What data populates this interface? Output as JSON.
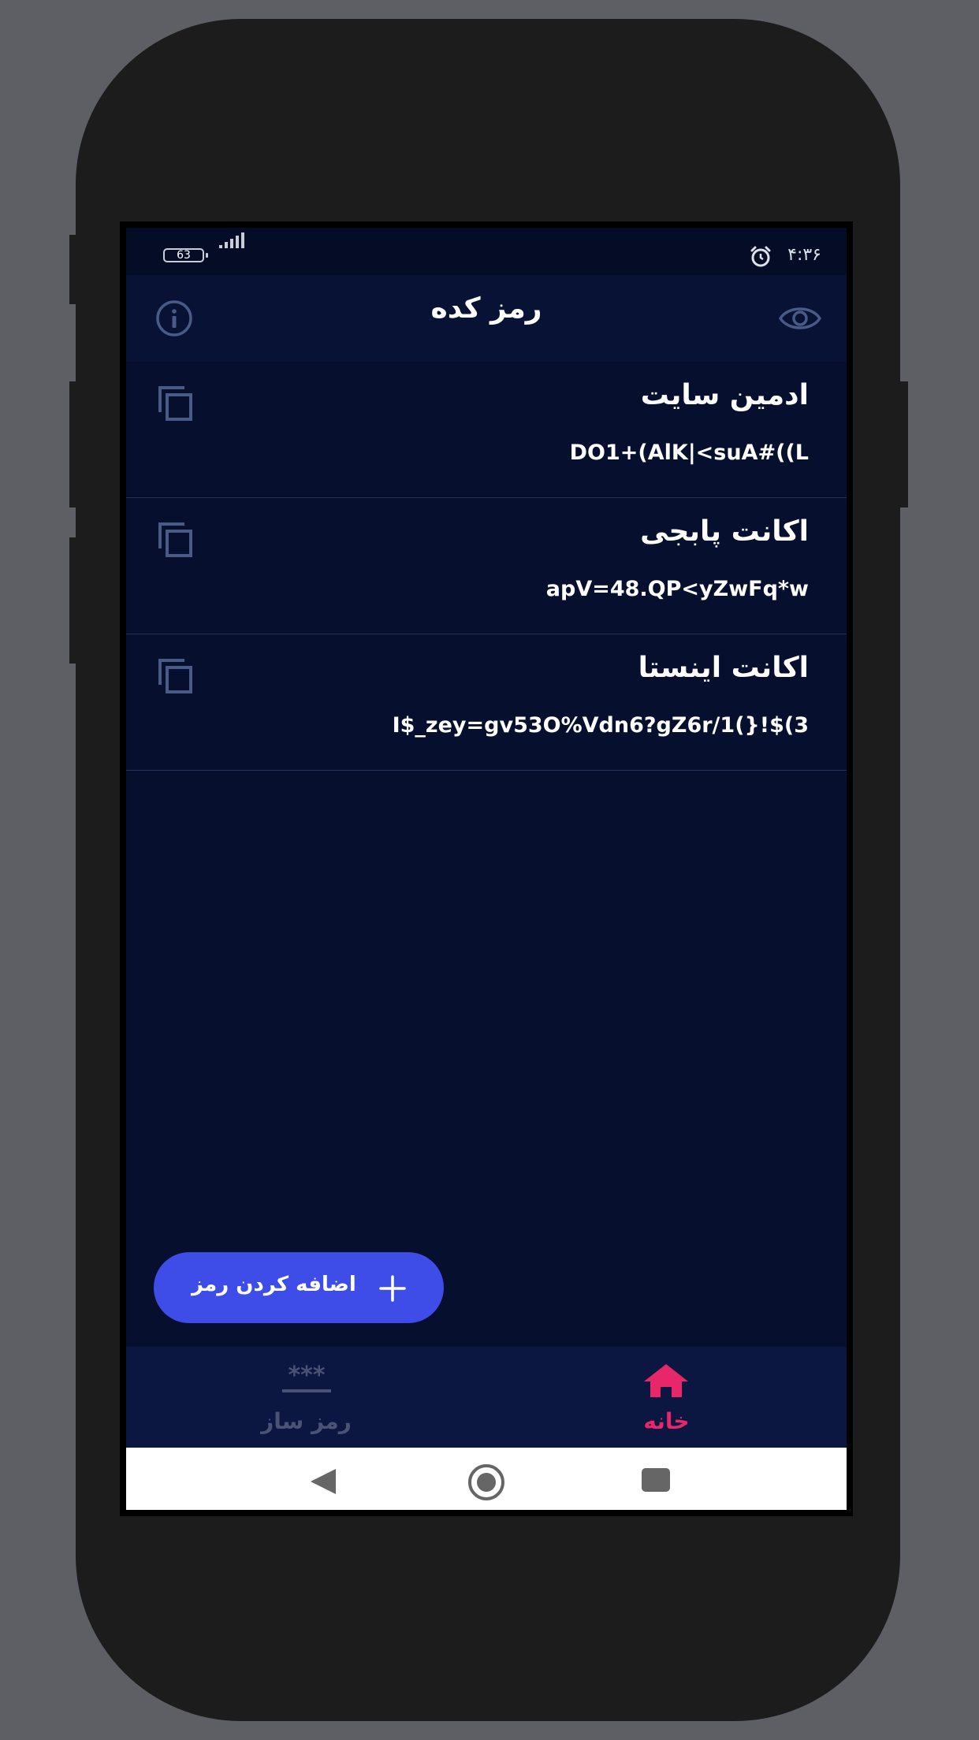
{
  "status_bar": {
    "battery": "63",
    "time": "۴:۳۶"
  },
  "header": {
    "title": "رمز کده"
  },
  "entries": [
    {
      "title": "ادمین سایت",
      "password": "DO1+(AlK|<suA#((L"
    },
    {
      "title": "اکانت پابجی",
      "password": "apV=48.QP<yZwFq*w"
    },
    {
      "title": "اکانت اینستا",
      "password": "I$_zey=gv53O%Vdn6?gZ6r/1(}!$(3"
    }
  ],
  "fab": {
    "label": "اضافه کردن رمز"
  },
  "bottom_nav": {
    "items": [
      {
        "label": "رمز ساز",
        "icon": "password-generator-icon",
        "active": false
      },
      {
        "label": "خانه",
        "icon": "home-icon",
        "active": true
      }
    ]
  },
  "colors": {
    "background": "#06102e",
    "accent": "#3e4de8",
    "active_nav": "#e8266a",
    "inactive_nav": "#4a5375",
    "icon_muted": "#4a5a86"
  }
}
